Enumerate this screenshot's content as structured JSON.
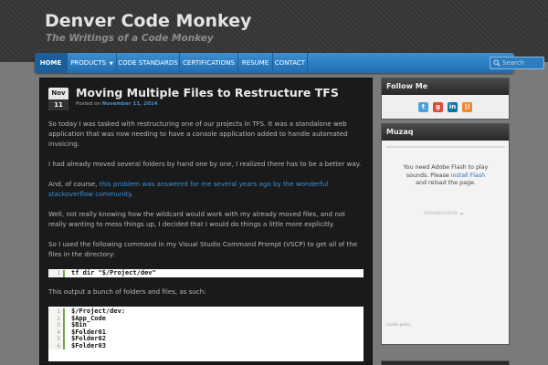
{
  "site": {
    "title": "Denver Code Monkey",
    "tagline": "The Writings of a Code Monkey"
  },
  "nav": {
    "items": [
      {
        "label": "HOME",
        "active": true
      },
      {
        "label": "PRODUCTS",
        "has_submenu": true
      },
      {
        "label": "CODE STANDARDS"
      },
      {
        "label": "CERTIFICATIONS"
      },
      {
        "label": "RESUME"
      },
      {
        "label": "CONTACT"
      }
    ],
    "search_placeholder": "Search"
  },
  "post": {
    "date_month": "Nov",
    "date_day": "11",
    "title": "Moving Multiple Files to Restructure TFS",
    "meta_prefix": "Posted on ",
    "meta_date": "November 11, 2014",
    "paragraphs": {
      "p1": "So today I was tasked with restructuring one of our projects in TFS. It was a standalone web application that was now needing to have a console application added to handle automated invoicing.",
      "p2": "I had already moved several folders by hand one by one, I realized there has to be a better way.",
      "p3_prefix": "And, of course, ",
      "p3_link": "this problem was answered for me several years ago by the wonderful stackoverflow community",
      "p3_suffix": ".",
      "p4": "Well, not really knowing how the wildcard would work with my already moved files, and not really wanting to mess things up, I decided that I would do things a little more explicitly.",
      "p5": "So I used the following command in my Visual Studio Command Prompt (VSCP) to get all of the files in the directory:",
      "p6": "This output a bunch of folders and files, as such:"
    },
    "code1": [
      {
        "num": "1",
        "text": "tf dir \"$/Project/dev\""
      }
    ],
    "code2": [
      {
        "num": "1",
        "text": "$/Project/dev:"
      },
      {
        "num": "2",
        "text": "$App_Code"
      },
      {
        "num": "3",
        "text": "$Bin"
      },
      {
        "num": "4",
        "text": "$Folder01"
      },
      {
        "num": "5",
        "text": "$Folder02"
      },
      {
        "num": "6",
        "text": "$Folder03"
      }
    ]
  },
  "sidebar": {
    "follow_title": "Follow Me",
    "social_icons": [
      "twitter-icon",
      "google-plus-icon",
      "linkedin-icon",
      "rss-icon"
    ],
    "muzaq_title": "Muzaq",
    "flash_text_1": "You need Adobe Flash to play sounds. Please ",
    "flash_link": "install Flash",
    "flash_text_2": " and reload the page.",
    "soundcloud_label": "SOUNDCLOUD",
    "cookie_label": "Cookie policy"
  },
  "colors": {
    "nav_blue": "#2a7dc3",
    "link_blue": "#3d8fd6",
    "post_bg": "#1a1a1a"
  }
}
